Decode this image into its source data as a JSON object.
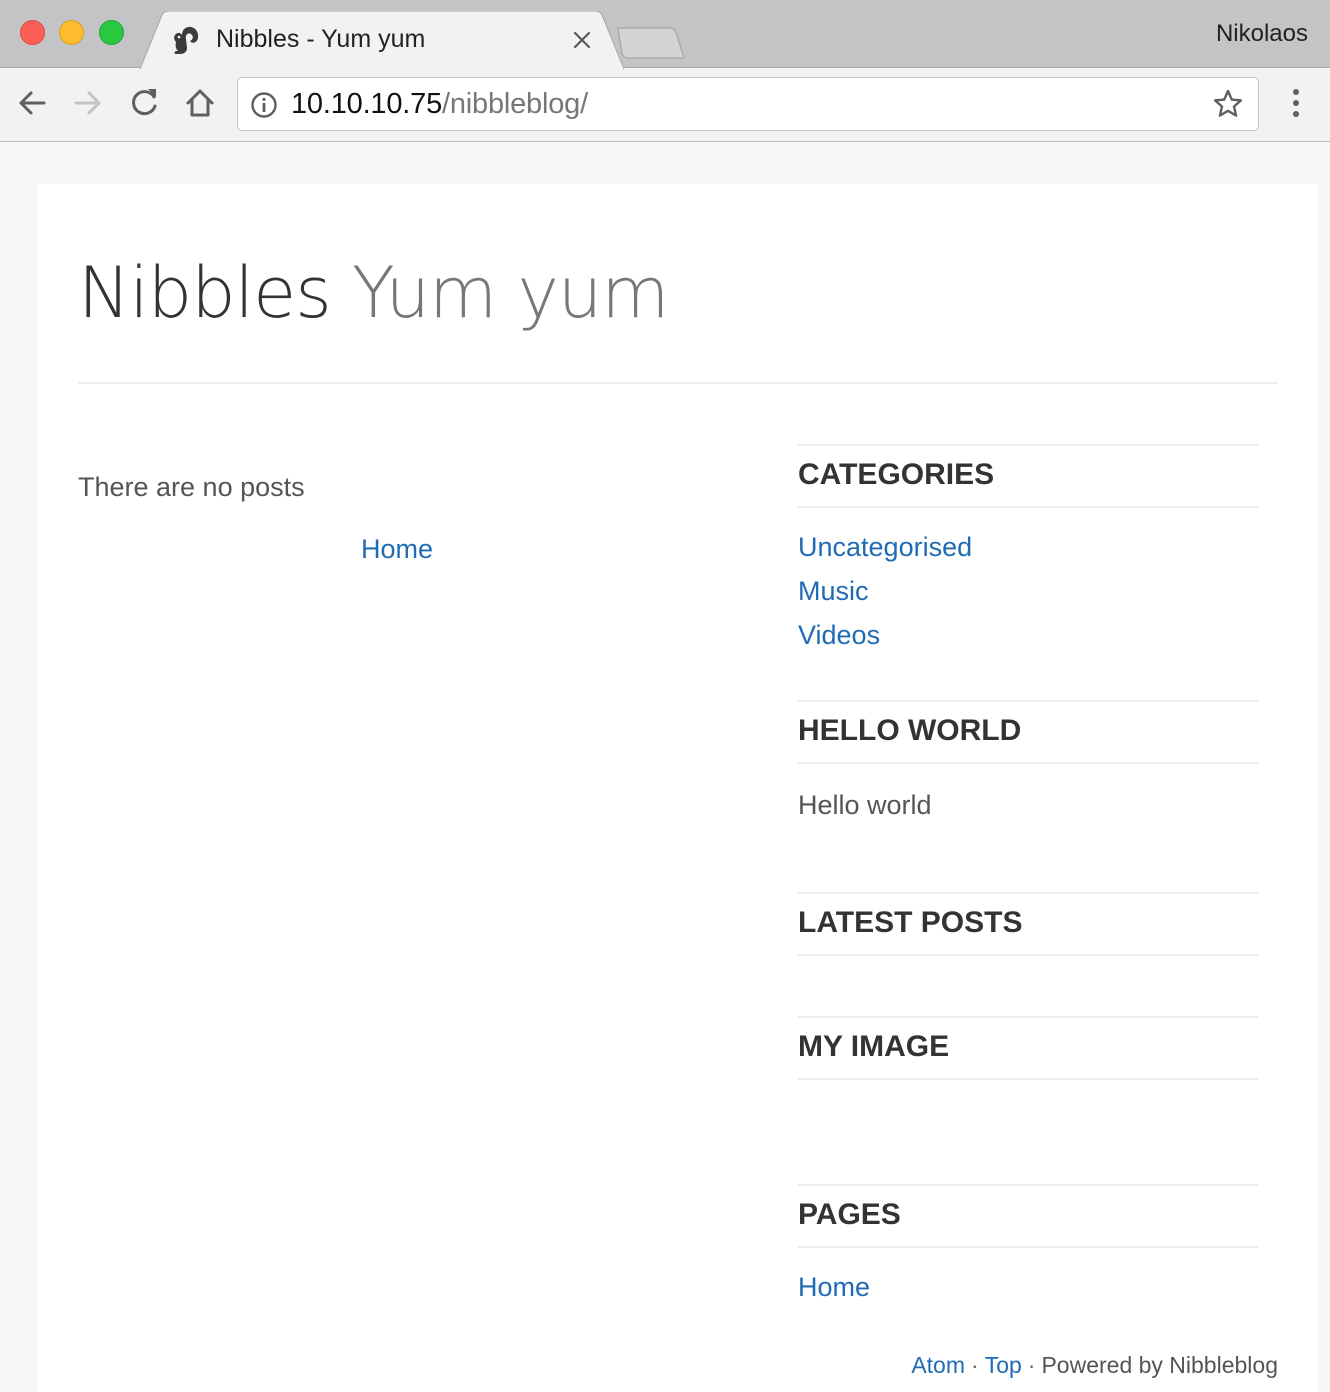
{
  "browser": {
    "tab_title": "Nibbles - Yum yum",
    "profile_name": "Nikolaos",
    "url_host": "10.10.10.75",
    "url_path": "/nibbleblog/",
    "icons": {
      "back": "arrow-left-icon",
      "forward": "arrow-right-icon",
      "reload": "reload-icon",
      "home": "home-icon",
      "info": "info-icon",
      "bookmark": "star-icon",
      "menu": "more-vert-icon",
      "close_tab": "close-icon",
      "favicon": "squirrel-favicon"
    }
  },
  "site": {
    "name": "Nibbles",
    "slogan": "Yum yum"
  },
  "main": {
    "empty_message": "There are no posts",
    "pager_home": "Home"
  },
  "sidebar": {
    "categories": {
      "title": "CATEGORIES",
      "items": [
        "Uncategorised",
        "Music",
        "Videos"
      ]
    },
    "hello_world": {
      "title": "HELLO WORLD",
      "text": "Hello world"
    },
    "latest_posts": {
      "title": "LATEST POSTS"
    },
    "my_image": {
      "title": "MY IMAGE"
    },
    "pages": {
      "title": "PAGES",
      "items": [
        "Home"
      ]
    }
  },
  "footer": {
    "atom": "Atom",
    "separator": "·",
    "top": "Top",
    "powered_by": "Powered by Nibbleblog"
  },
  "colors": {
    "link": "#1f6bb5",
    "text": "#555555",
    "heading": "#333333",
    "slogan": "#777777"
  }
}
